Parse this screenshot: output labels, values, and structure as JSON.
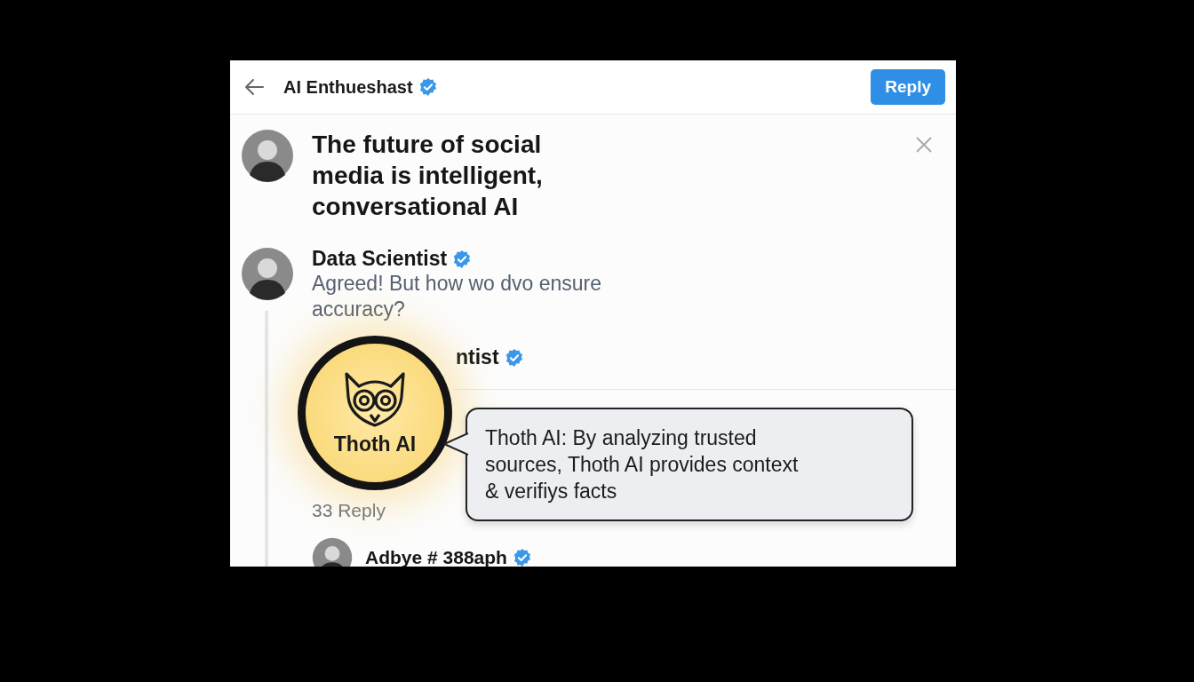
{
  "header": {
    "title": "AI Enthueshast",
    "verified": true,
    "reply_button": "Reply"
  },
  "post": {
    "text": "The future of social media is intelligent, conversational AI"
  },
  "comments": [
    {
      "author": "Data Scientist",
      "verified": true,
      "text": "Agreed! But how wo dvo ensure accuracy?"
    },
    {
      "author": "ntist",
      "verified": true
    }
  ],
  "reply_count": "33 Reply",
  "next_comment": {
    "author": "Adbye # 388aph",
    "verified": true
  },
  "assistant_badge": {
    "label": "Thoth AI"
  },
  "assistant_bubble": {
    "text": "Thoth AI: By analyzing trusted sources, Thoth AI provides context & verifiys facts"
  }
}
